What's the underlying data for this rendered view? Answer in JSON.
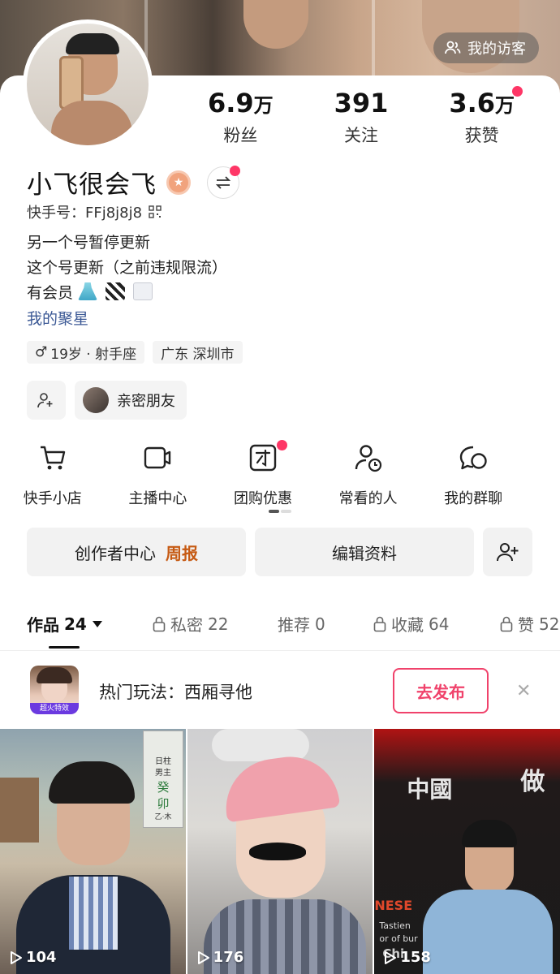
{
  "header": {
    "visitor_label": "我的访客"
  },
  "stats": [
    {
      "value": "6.9",
      "unit": "万",
      "label": "粉丝"
    },
    {
      "value": "391",
      "unit": "",
      "label": "关注"
    },
    {
      "value": "3.6",
      "unit": "万",
      "label": "获赞"
    }
  ],
  "profile": {
    "name": "小飞很会飞",
    "uid": "快手号：FFj8j8j8",
    "bio": [
      "另一个号暂停更新",
      "这个号更新（之前违规限流）",
      "有会员"
    ],
    "fan_group_link": "我的聚星",
    "tags": [
      "19岁 · 射手座",
      "广东 深圳市"
    ],
    "close_friends_label": "亲密朋友"
  },
  "tools": [
    {
      "label": "快手小店",
      "icon": "cart-icon"
    },
    {
      "label": "主播中心",
      "icon": "video-camera-icon"
    },
    {
      "label": "团购优惠",
      "icon": "group-buy-icon"
    },
    {
      "label": "常看的人",
      "icon": "recent-person-icon"
    },
    {
      "label": "我的群聊",
      "icon": "group-chat-icon"
    }
  ],
  "actions": {
    "creator_center": "创作者中心",
    "creator_highlight": "周报",
    "edit_profile": "编辑资料"
  },
  "tabs": [
    {
      "label": "作品",
      "count": "24",
      "active": true
    },
    {
      "label": "私密",
      "count": "22",
      "locked": true
    },
    {
      "label": "推荐",
      "count": "0"
    },
    {
      "label": "收藏",
      "count": "64",
      "locked": true
    },
    {
      "label": "赞",
      "count": "52",
      "locked": true
    }
  ],
  "promo": {
    "text": "热门玩法：西厢寻他",
    "thumb_caption": "超火特效",
    "publish_label": "去发布"
  },
  "videos": [
    {
      "plays": "104",
      "overlay": [
        "日柱",
        "男主",
        "癸",
        "卯",
        "乙·木"
      ]
    },
    {
      "plays": "176"
    },
    {
      "plays": "158",
      "overlay": [
        "中",
        "國",
        "做",
        "NESE",
        "Tastien",
        "or of bur",
        "Chi"
      ]
    }
  ],
  "colors": {
    "accent": "#fe3666",
    "link": "#3d5a96",
    "highlight": "#c65a13"
  }
}
